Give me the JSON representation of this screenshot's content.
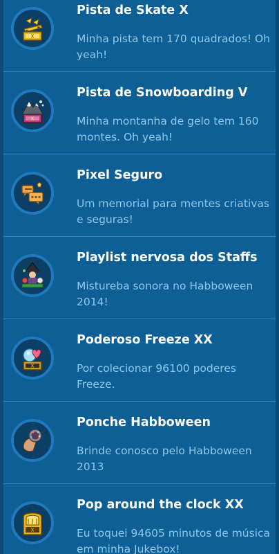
{
  "achievements": [
    {
      "title": "Pista de Skate X",
      "description": "Minha pista tem 170 quadrados! Oh yeah!",
      "icon": "gold-skate-trophy-icon"
    },
    {
      "title": "Pista de Snowboarding V",
      "description": "Minha montanha de gelo tem 160 montes. Oh yeah!",
      "icon": "snow-mountain-trophy-icon"
    },
    {
      "title": "Pixel Seguro",
      "description": "Um memorial para mentes criativas e seguras!",
      "icon": "chat-bubbles-icon"
    },
    {
      "title": "Playlist nervosa dos Staffs",
      "description": "Mistureba sonora no Habboween 2014!",
      "icon": "witch-cauldron-icon"
    },
    {
      "title": "Poderoso Freeze XX",
      "description": "Por colecionar 96100 poderes Freeze.",
      "icon": "freeze-heart-trophy-icon"
    },
    {
      "title": "Ponche Habboween",
      "description": "Brinde conosco pelo Habboween 2013",
      "icon": "punch-glass-icon"
    },
    {
      "title": "Pop around the clock XX",
      "description": "Eu toquei 94605 minutos de música em minha Jukebox!",
      "icon": "gold-jukebox-trophy-icon"
    }
  ],
  "colors": {
    "background": "#0e5f95",
    "divider": "#2a87c8",
    "title": "#ffffff",
    "description": "#8fc9ee",
    "badge_ring": "#1f79bd"
  }
}
